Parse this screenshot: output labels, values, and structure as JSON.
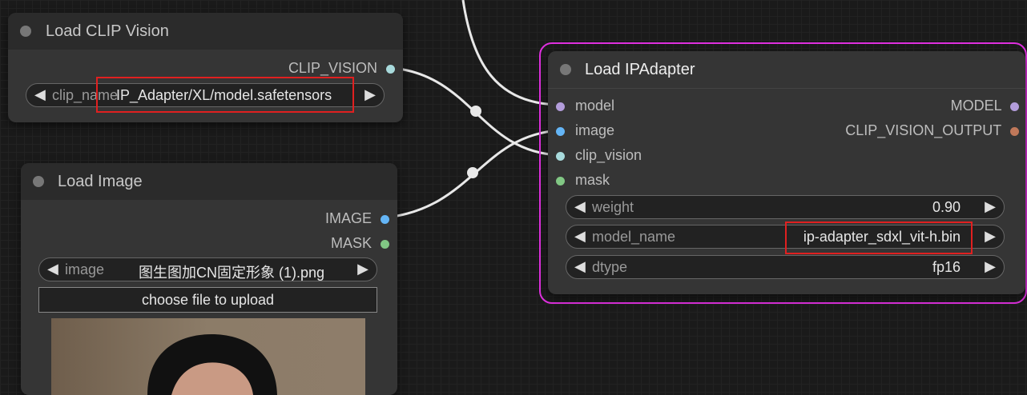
{
  "nodes": {
    "clip_vision": {
      "title": "Load CLIP Vision",
      "output": "CLIP_VISION",
      "widget": {
        "label": "clip_name",
        "value": "IP_Adapter/XL/model.safetensors"
      }
    },
    "load_image": {
      "title": "Load Image",
      "outputs": [
        "IMAGE",
        "MASK"
      ],
      "widget": {
        "label": "image",
        "value": "图生图加CN固定形象 (1).png"
      },
      "upload_label": "choose file to upload"
    },
    "ipadapter": {
      "title": "Load IPAdapter",
      "inputs": [
        "model",
        "image",
        "clip_vision",
        "mask"
      ],
      "outputs": [
        "MODEL",
        "CLIP_VISION_OUTPUT"
      ],
      "widgets": [
        {
          "label": "weight",
          "value": "0.90"
        },
        {
          "label": "model_name",
          "value": "ip-adapter_sdxl_vit-h.bin"
        },
        {
          "label": "dtype",
          "value": "fp16"
        }
      ]
    }
  },
  "colors": {
    "model": "#b39ddb",
    "image": "#64b5f6",
    "clip_vision": "#a8dadc",
    "mask": "#81c784",
    "clip_vision_output": "#c0785a",
    "highlight": "#e030e0",
    "annotation": "#e02020"
  },
  "icons": {
    "left_arrow": "◀",
    "right_arrow": "▶"
  }
}
